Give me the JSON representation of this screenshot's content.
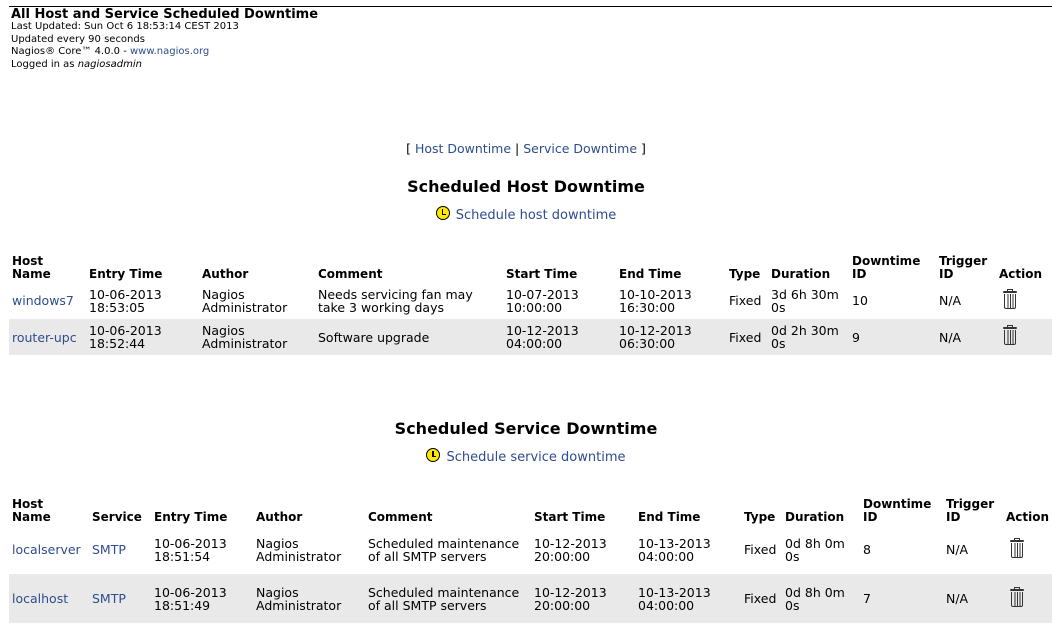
{
  "header": {
    "title": "All Host and Service Scheduled Downtime",
    "last_updated": "Last Updated: Sun Oct 6 18:53:14 CEST 2013",
    "update_interval": "Updated every 90 seconds",
    "version_prefix": "Nagios® Core™ 4.0.0 - ",
    "version_link": "www.nagios.org",
    "logged_in_prefix": "Logged in as ",
    "logged_in_user": "nagiosadmin"
  },
  "switcher": {
    "open": "[ ",
    "host_link": "Host Downtime",
    "sep": " | ",
    "service_link": "Service Downtime",
    "close": " ]"
  },
  "host_section": {
    "title": "Scheduled Host Downtime",
    "schedule_link": "Schedule host downtime",
    "columns": {
      "host": "Host Name",
      "entry": "Entry Time",
      "author": "Author",
      "comment": "Comment",
      "start": "Start Time",
      "end": "End Time",
      "type": "Type",
      "duration": "Duration",
      "id": "Downtime ID",
      "trigger": "Trigger ID",
      "action": "Action"
    },
    "rows": [
      {
        "host": "windows7",
        "entry": "10-06-2013 18:53:05",
        "author": "Nagios Administrator",
        "comment": "Needs servicing fan may take 3 working days",
        "start": "10-07-2013 10:00:00",
        "end": "10-10-2013 16:30:00",
        "type": "Fixed",
        "duration": "3d 6h 30m 0s",
        "id": "10",
        "trigger": "N/A"
      },
      {
        "host": "router-upc",
        "entry": "10-06-2013 18:52:44",
        "author": "Nagios Administrator",
        "comment": "Software upgrade",
        "start": "10-12-2013 04:00:00",
        "end": "10-12-2013 06:30:00",
        "type": "Fixed",
        "duration": "0d 2h 30m 0s",
        "id": "9",
        "trigger": "N/A"
      }
    ]
  },
  "service_section": {
    "title": "Scheduled Service Downtime",
    "schedule_link": "Schedule service downtime",
    "columns": {
      "host": "Host Name",
      "service": "Service",
      "entry": "Entry Time",
      "author": "Author",
      "comment": "Comment",
      "start": "Start Time",
      "end": "End Time",
      "type": "Type",
      "duration": "Duration",
      "id": "Downtime ID",
      "trigger": "Trigger ID",
      "action": "Action"
    },
    "rows": [
      {
        "host": "localserver",
        "service": "SMTP",
        "entry": "10-06-2013 18:51:54",
        "author": "Nagios Administrator",
        "comment": "Scheduled maintenance of all SMTP servers",
        "start": "10-12-2013 20:00:00",
        "end": "10-13-2013 04:00:00",
        "type": "Fixed",
        "duration": "0d 8h 0m 0s",
        "id": "8",
        "trigger": "N/A"
      },
      {
        "host": "localhost",
        "service": "SMTP",
        "entry": "10-06-2013 18:51:49",
        "author": "Nagios Administrator",
        "comment": "Scheduled maintenance of all SMTP servers",
        "start": "10-12-2013 20:00:00",
        "end": "10-13-2013 04:00:00",
        "type": "Fixed",
        "duration": "0d 8h 0m 0s",
        "id": "7",
        "trigger": "N/A"
      }
    ]
  },
  "icons": {
    "schedule": "clock-icon",
    "delete": "trash-icon"
  },
  "colors": {
    "link": "#2e4c8f",
    "row_even": "#e9e9e9",
    "clock": "#ffe800"
  }
}
